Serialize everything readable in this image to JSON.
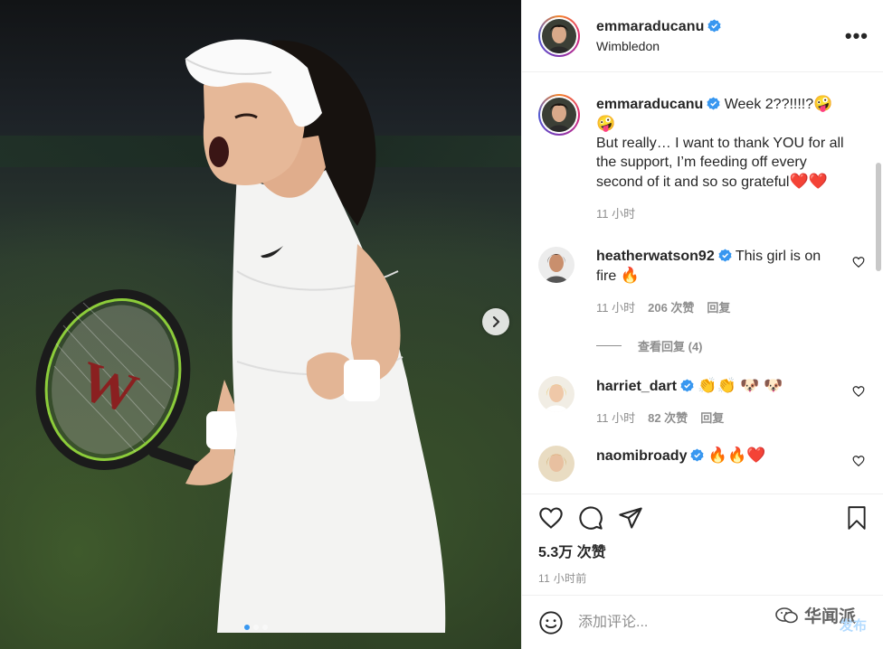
{
  "post": {
    "username": "emmaraducanu",
    "location": "Wimbledon",
    "more_label": "•••",
    "caption": {
      "username": "emmaraducanu",
      "line1": "Week 2??!!!!?",
      "line1_emoji": "🤪",
      "line2_emoji": "🤪",
      "body": "But really… I want to thank YOU for all the support, I’m feeding off every second of it and so so grateful",
      "hearts": "❤️❤️",
      "time": "11 小时"
    },
    "media": {
      "slides_total": 3,
      "active_slide": 1
    }
  },
  "comments": [
    {
      "username": "heatherwatson92",
      "verified": true,
      "text": "This girl is on fire",
      "emoji": "🔥",
      "time": "11 小时",
      "likes": "206 次赞",
      "reply": "回复",
      "view_replies": "查看回复 (4)"
    },
    {
      "username": "harriet_dart",
      "verified": true,
      "text": "",
      "emoji": "👏👏 🐶 🐶",
      "time": "11 小时",
      "likes": "82 次赞",
      "reply": "回复"
    },
    {
      "username": "naomibroady",
      "verified": true,
      "text": "",
      "emoji": "🔥🔥❤️"
    }
  ],
  "actions": {
    "likes": "5.3万 次赞",
    "posted": "11 小时前"
  },
  "add_comment": {
    "placeholder": "添加评论...",
    "post_label": "发布",
    "watermark": "华闻派"
  },
  "colors": {
    "ring": [
      "#f58529",
      "#dd2a7b",
      "#8134af",
      "#515bd4"
    ],
    "verified": "#3897f0",
    "secondary_text": "#8e8e8e"
  }
}
